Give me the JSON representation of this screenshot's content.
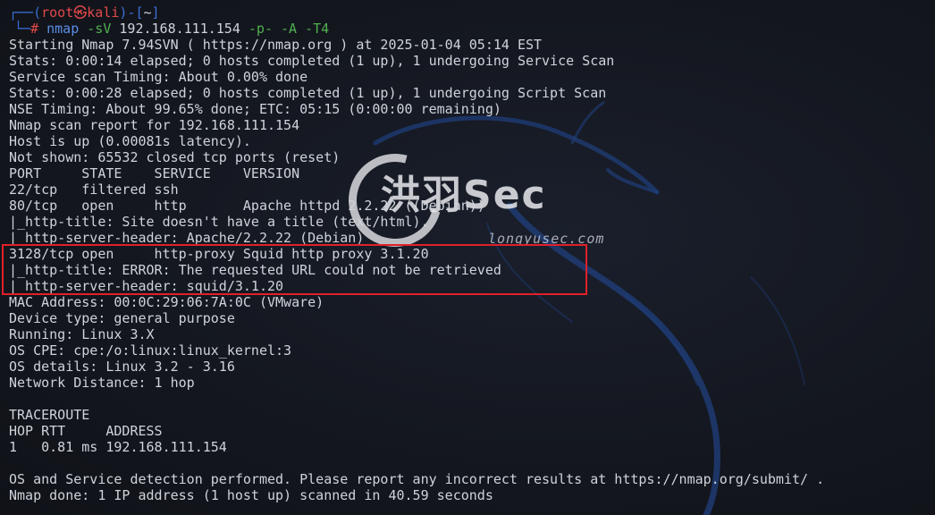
{
  "prompt": {
    "top_left_frame": "┌──(",
    "user": "root",
    "skull": "㉿",
    "host": "kali",
    "mid_frame": ")-[",
    "cwd": "~",
    "end_frame": "]",
    "bottom_frame": "└─",
    "hash": "#"
  },
  "command": {
    "name": "nmap",
    "flag1": "-sV",
    "target": "192.168.111.154",
    "flag2": "-p-",
    "flag3": "-A",
    "flag4": "-T4"
  },
  "output_lines": [
    "Starting Nmap 7.94SVN ( https://nmap.org ) at 2025-01-04 05:14 EST",
    "Stats: 0:00:14 elapsed; 0 hosts completed (1 up), 1 undergoing Service Scan",
    "Service scan Timing: About 0.00% done",
    "Stats: 0:00:28 elapsed; 0 hosts completed (1 up), 1 undergoing Script Scan",
    "NSE Timing: About 99.65% done; ETC: 05:15 (0:00:00 remaining)",
    "Nmap scan report for 192.168.111.154",
    "Host is up (0.00081s latency).",
    "Not shown: 65532 closed tcp ports (reset)",
    "PORT     STATE    SERVICE    VERSION",
    "22/tcp   filtered ssh",
    "80/tcp   open     http       Apache httpd 2.2.22 ((Debian))",
    "|_http-title: Site doesn't have a title (text/html).",
    "|_http-server-header: Apache/2.2.22 (Debian)",
    "3128/tcp open     http-proxy Squid http proxy 3.1.20",
    "|_http-title: ERROR: The requested URL could not be retrieved",
    "|_http-server-header: squid/3.1.20",
    "MAC Address: 00:0C:29:06:7A:0C (VMware)",
    "Device type: general purpose",
    "Running: Linux 3.X",
    "OS CPE: cpe:/o:linux:linux_kernel:3",
    "OS details: Linux 3.2 - 3.16",
    "Network Distance: 1 hop",
    "",
    "TRACEROUTE",
    "HOP RTT     ADDRESS",
    "1   0.81 ms 192.168.111.154",
    "",
    "OS and Service detection performed. Please report any incorrect results at https://nmap.org/submit/ .",
    "Nmap done: 1 IP address (1 host up) scanned in 40.59 seconds"
  ],
  "watermark": {
    "brand": "洪羽Sec",
    "url": "longyusec.com"
  },
  "colors": {
    "background": "#14171f",
    "text": "#cfd3da",
    "prompt_frame": "#3b6fd8",
    "prompt_user": "#e24a4a",
    "command": "#5b8fe6",
    "flags": "#4fb04f",
    "highlight": "#e0202a"
  }
}
